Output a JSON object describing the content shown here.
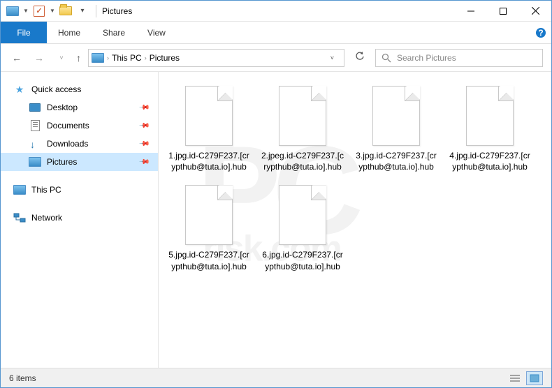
{
  "window": {
    "title": "Pictures"
  },
  "ribbon": {
    "tabs": [
      "File",
      "Home",
      "Share",
      "View"
    ]
  },
  "address": {
    "crumbs": [
      "This PC",
      "Pictures"
    ]
  },
  "search": {
    "placeholder": "Search Pictures"
  },
  "sidebar": {
    "quick_access": "Quick access",
    "items": [
      "Desktop",
      "Documents",
      "Downloads",
      "Pictures"
    ],
    "this_pc": "This PC",
    "network": "Network"
  },
  "files": [
    "1.jpg.id-C279F237.[crypthub@tuta.io].hub",
    "2.jpeg.id-C279F237.[crypthub@tuta.io].hub",
    "3.jpg.id-C279F237.[crypthub@tuta.io].hub",
    "4.jpg.id-C279F237.[crypthub@tuta.io].hub",
    "5.jpg.id-C279F237.[crypthub@tuta.io].hub",
    "6.jpg.id-C279F237.[crypthub@tuta.io].hub"
  ],
  "status": {
    "item_count": "6 items"
  }
}
